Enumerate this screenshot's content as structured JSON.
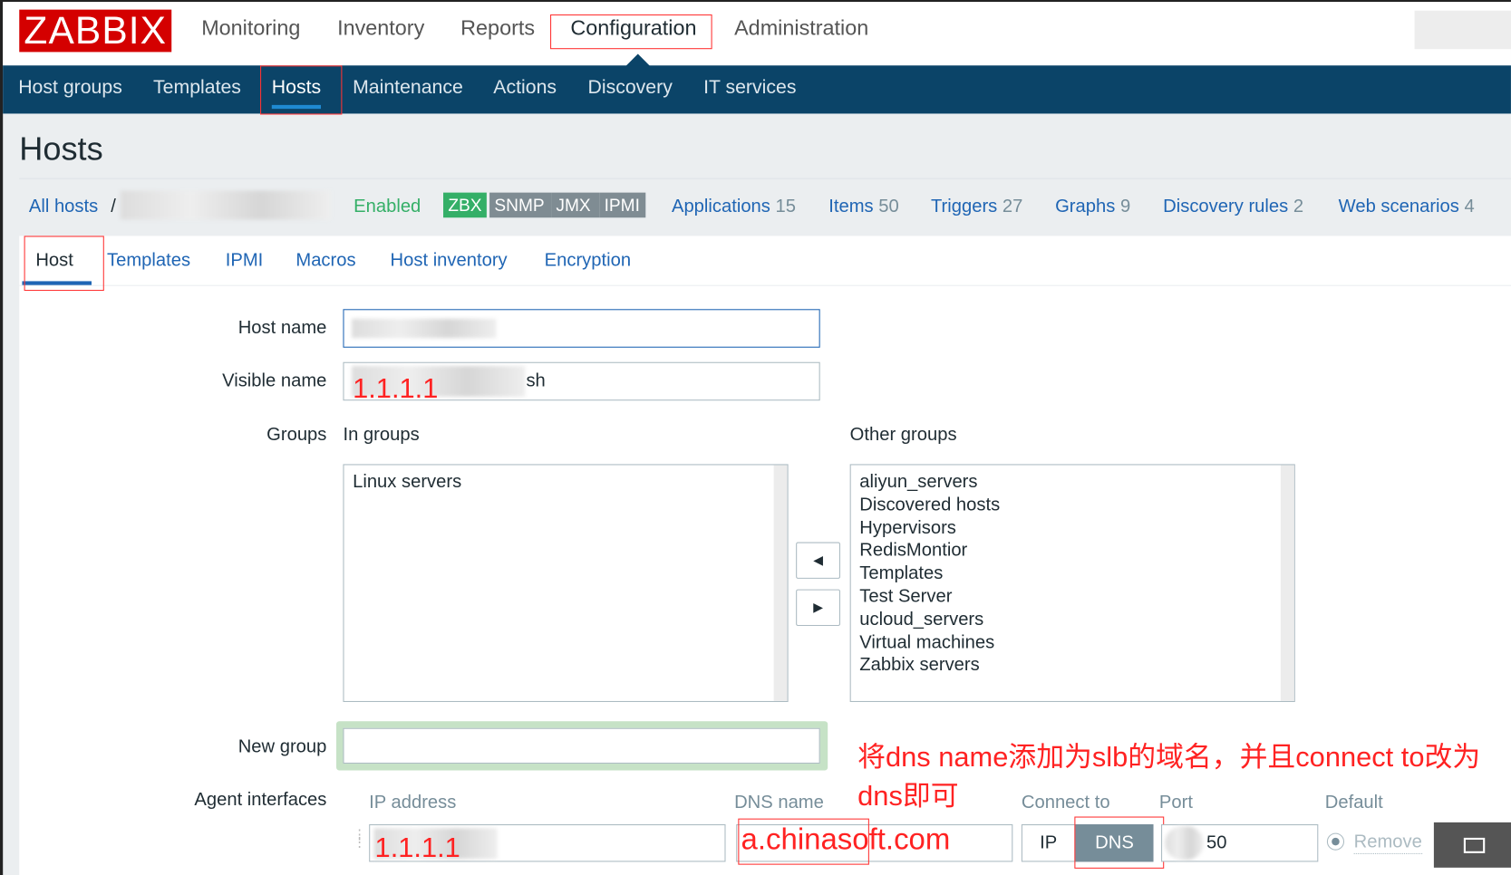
{
  "logo": "ZABBIX",
  "main_nav": [
    "Monitoring",
    "Inventory",
    "Reports",
    "Configuration",
    "Administration"
  ],
  "sub_nav": [
    "Host groups",
    "Templates",
    "Hosts",
    "Maintenance",
    "Actions",
    "Discovery",
    "IT services"
  ],
  "page_title": "Hosts",
  "breadcrumb": {
    "all_hosts": "All hosts",
    "sep": "/",
    "status": "Enabled"
  },
  "availability": [
    "ZBX",
    "SNMP",
    "JMX",
    "IPMI"
  ],
  "links": [
    {
      "label": "Applications",
      "count": "15"
    },
    {
      "label": "Items",
      "count": "50"
    },
    {
      "label": "Triggers",
      "count": "27"
    },
    {
      "label": "Graphs",
      "count": "9"
    },
    {
      "label": "Discovery rules",
      "count": "2"
    },
    {
      "label": "Web scenarios",
      "count": "4"
    }
  ],
  "tabs": [
    "Host",
    "Templates",
    "IPMI",
    "Macros",
    "Host inventory",
    "Encryption"
  ],
  "form": {
    "host_name_label": "Host name",
    "visible_name_label": "Visible name",
    "visible_name_suffix": "sh",
    "visible_name_annot": "1.1.1.1",
    "groups_label": "Groups",
    "in_groups_label": "In groups",
    "other_groups_label": "Other groups",
    "in_groups": [
      "Linux servers"
    ],
    "other_groups": [
      "aliyun_servers",
      "Discovered hosts",
      "Hypervisors",
      "RedisMontior",
      "Templates",
      "Test Server",
      "ucloud_servers",
      "Virtual machines",
      "Zabbix servers"
    ],
    "new_group_label": "New group",
    "agent_label": "Agent interfaces"
  },
  "interface": {
    "headers": [
      "IP address",
      "DNS name",
      "Connect to",
      "Port",
      "Default"
    ],
    "ip": "1.1.1.1",
    "dns": "a.chinasoft.com",
    "connect_ip": "IP",
    "connect_dns": "DNS",
    "port": "50",
    "remove": "Remove"
  },
  "annotation": "将dns name添加为slb的域名，并且connect to改为dns即可",
  "colors": {
    "brand": "#d40000",
    "nav": "#0b4468",
    "link": "#1f65b4",
    "zbx": "#34af67",
    "annot": "#ff2222"
  }
}
